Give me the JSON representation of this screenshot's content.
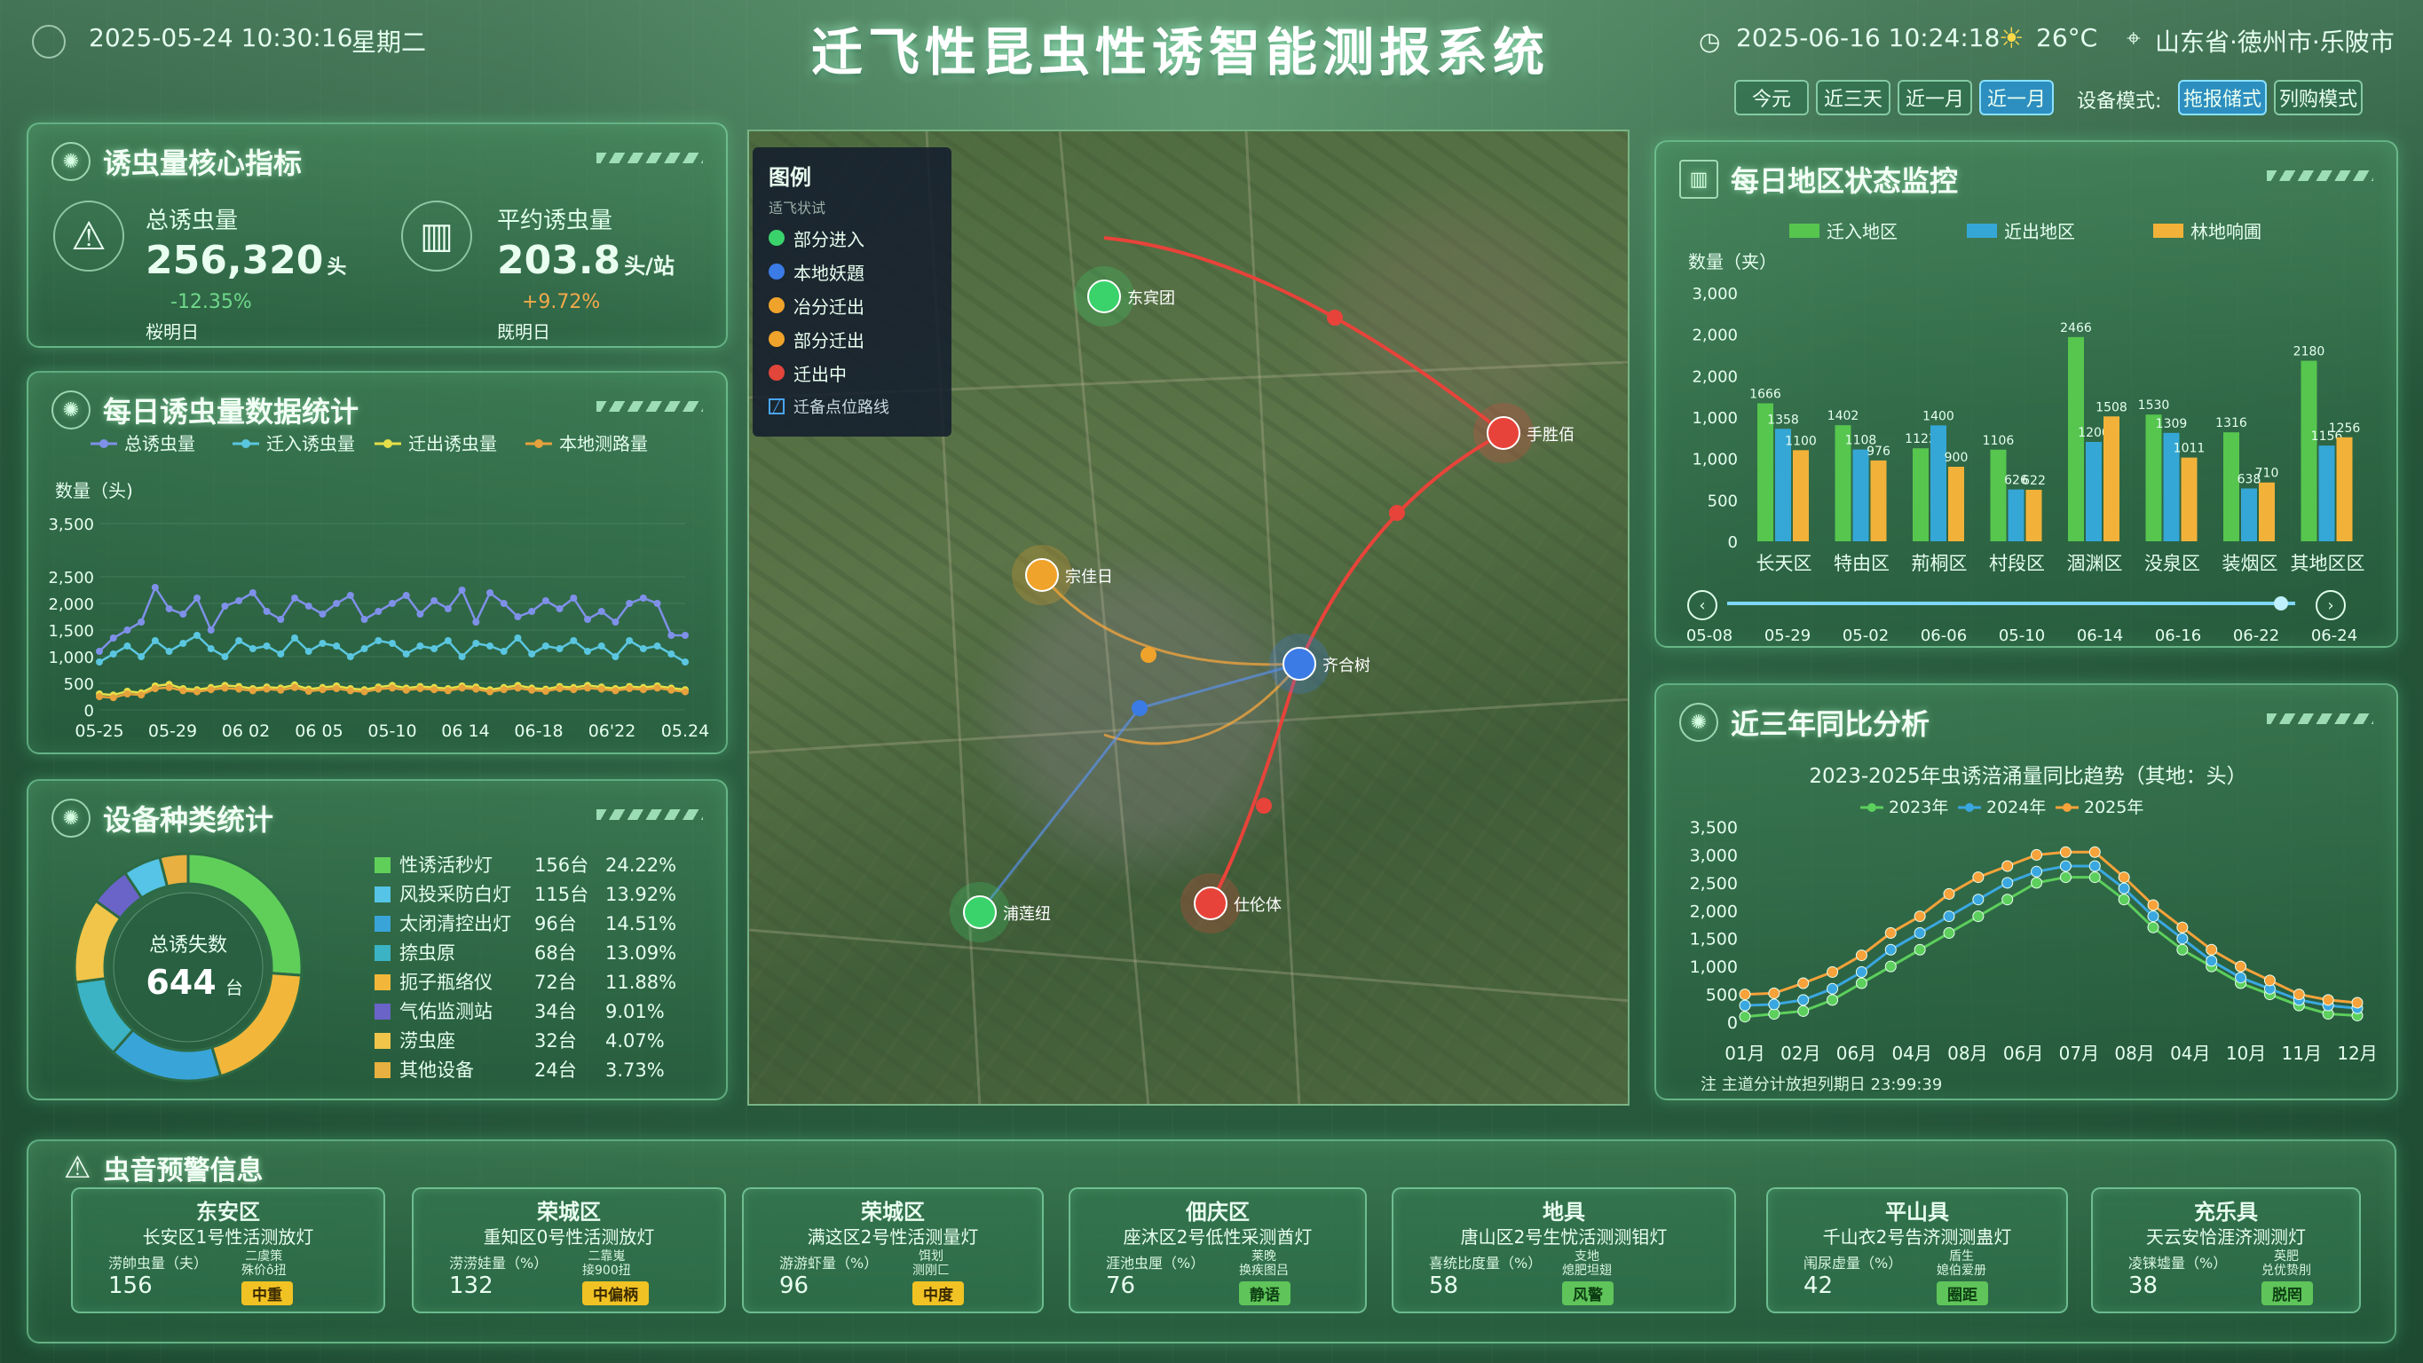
{
  "header": {
    "left_datetime": "2025-05-24 10:30:16",
    "weekday": "星期二",
    "title": "迁飞性昆虫性诱智能测报系统",
    "right_datetime": "2025-06-16 10:24:18",
    "temperature": "26°C",
    "location": "山东省·徳州市·乐陂市"
  },
  "time_filters": [
    {
      "label": "今元",
      "active": false
    },
    {
      "label": "近三天",
      "active": false
    },
    {
      "label": "近一月",
      "active": false
    },
    {
      "label": "近一月",
      "active": true
    }
  ],
  "device_mode": {
    "label": "设备模式:",
    "options": [
      {
        "label": "拖报储式",
        "active": true
      },
      {
        "label": "列购模式",
        "active": false
      }
    ]
  },
  "core": {
    "title": "诱虫量核心指标",
    "total": {
      "label": "总诱虫量",
      "value": "256,320",
      "unit": "头",
      "change": "-12.35%",
      "sub": "桜明日"
    },
    "avg": {
      "label": "平约诱虫量",
      "value": "203.8",
      "unit": "头/站",
      "change": "+9.72%",
      "sub": "既明日"
    }
  },
  "daily": {
    "title": "每日诱虫量数据统计",
    "ylabel": "数量（头)",
    "legend": [
      "总诱虫量",
      "迁入诱虫量",
      "迁出诱虫量",
      "本地测路量"
    ],
    "xticks": [
      "05-25",
      "05-29",
      "06 02",
      "06 05",
      "05-10",
      "06 14",
      "06-18",
      "06'22",
      "05.24"
    ],
    "yticks": [
      "0",
      "500",
      "1,000",
      "1,500",
      "2,000",
      "2,500",
      "3,500"
    ]
  },
  "chart_data": [
    {
      "type": "line",
      "title": "每日诱虫量数据统计",
      "ylabel": "数量（头)",
      "ylim": [
        0,
        3500
      ],
      "series": [
        {
          "name": "总诱虫量",
          "color": "#7f90e8",
          "values": [
            1100,
            1350,
            1500,
            1650,
            2300,
            1900,
            1800,
            2100,
            1500,
            1950,
            2050,
            2200,
            1850,
            1700,
            2100,
            1950,
            1800,
            2000,
            2150,
            1700,
            1850,
            2000,
            2150,
            1800,
            2050,
            1900,
            2250,
            1650,
            2200,
            2000,
            1750,
            1850,
            2050,
            1900,
            2100,
            1700,
            1850,
            1650,
            2000,
            2100,
            2000,
            1400,
            1400
          ]
        },
        {
          "name": "迁入诱虫量",
          "color": "#5bc6e0",
          "values": [
            900,
            1050,
            1200,
            1000,
            1300,
            1100,
            1250,
            1400,
            1150,
            1000,
            1300,
            1150,
            1200,
            1050,
            1350,
            1100,
            1250,
            1200,
            1000,
            1150,
            1300,
            1250,
            1050,
            1200,
            1150,
            1300,
            1000,
            1250,
            1200,
            1100,
            1350,
            1050,
            1200,
            1150,
            1300,
            1100,
            1200,
            1000,
            1300,
            1150,
            1200,
            1050,
            900
          ]
        },
        {
          "name": "迁出诱虫量",
          "color": "#e6df4a",
          "values": [
            300,
            280,
            350,
            320,
            450,
            480,
            400,
            380,
            420,
            460,
            440,
            400,
            430,
            410,
            470,
            390,
            420,
            450,
            400,
            380,
            430,
            460,
            410,
            440,
            420,
            400,
            450,
            430,
            380,
            420,
            460,
            410,
            390,
            440,
            420,
            460,
            430,
            400,
            440,
            420,
            450,
            410,
            380
          ]
        },
        {
          "name": "本地测路量",
          "color": "#e6a23c",
          "values": [
            250,
            230,
            300,
            280,
            400,
            420,
            360,
            340,
            380,
            410,
            390,
            360,
            390,
            370,
            420,
            350,
            380,
            400,
            360,
            340,
            390,
            410,
            370,
            400,
            380,
            360,
            410,
            390,
            340,
            380,
            410,
            370,
            350,
            400,
            380,
            410,
            390,
            360,
            400,
            380,
            410,
            370,
            340
          ]
        }
      ]
    },
    {
      "type": "bar",
      "title": "每日地区状态监控",
      "ylabel": "数量（头)",
      "ylim": [
        0,
        3000
      ],
      "categories": [
        "长天区",
        "特由区",
        "荊桐区",
        "村段区",
        "涸渊区",
        "没泉区",
        "装烟区",
        "其地区区"
      ],
      "series": [
        {
          "name": "迁入地区",
          "color": "#56c64e",
          "values": [
            1666,
            1402,
            1123,
            1106,
            2466,
            1530,
            1316,
            2180
          ]
        },
        {
          "name": "近出地区",
          "color": "#35a7d6",
          "values": [
            1358,
            1108,
            1400,
            626,
            1200,
            1309,
            638,
            1156
          ]
        },
        {
          "name": "林地响圃",
          "color": "#f2b23a",
          "values": [
            1100,
            976,
            900,
            622,
            1508,
            1011,
            710,
            1256
          ]
        }
      ]
    },
    {
      "type": "line",
      "title": "2023-2025年虫诱涪涌量同比趋势（其地：头）",
      "ylim": [
        0,
        3500
      ],
      "categories": [
        "01月",
        "02月",
        "06月",
        "04月",
        "08月",
        "06月",
        "07月",
        "08月",
        "04月",
        "10月",
        "11月",
        "12月"
      ],
      "series": [
        {
          "name": "2023年",
          "color": "#5ccf5c",
          "values": [
            100,
            150,
            200,
            400,
            700,
            1000,
            1300,
            1600,
            1900,
            2200,
            2500,
            2600,
            2600,
            2200,
            1700,
            1300,
            1000,
            700,
            500,
            300,
            150,
            120
          ]
        },
        {
          "name": "2024年",
          "color": "#3aa7e0",
          "values": [
            300,
            320,
            400,
            600,
            900,
            1300,
            1600,
            1900,
            2200,
            2500,
            2700,
            2800,
            2800,
            2400,
            1900,
            1500,
            1100,
            800,
            600,
            400,
            300,
            250
          ]
        },
        {
          "name": "2025年",
          "color": "#f7a23a",
          "values": [
            500,
            520,
            700,
            900,
            1200,
            1600,
            1900,
            2300,
            2600,
            2800,
            3000,
            3050,
            3050,
            2600,
            2100,
            1700,
            1300,
            1000,
            750,
            500,
            400,
            350
          ]
        }
      ]
    },
    {
      "type": "pie",
      "title": "设备种类统计",
      "center_label": "总诱失数",
      "center_value": "644",
      "center_unit": "台",
      "categories": [
        "性诱活秒灯",
        "风投采防白灯",
        "太闭清控出灯",
        "捺虫原",
        "扼子瓶络仪",
        "气佑监测站",
        "涝虫座",
        "其他设备"
      ],
      "values": [
        156,
        115,
        96,
        68,
        72,
        34,
        32,
        24
      ],
      "labels": [
        "156台",
        "115台",
        "96台",
        "68台",
        "72台",
        "34台",
        "32台",
        "24台"
      ],
      "percents": [
        "24.22%",
        "13.92%",
        "14.51%",
        "13.09%",
        "11.88%",
        "9.01%",
        "4.07%",
        "3.73%"
      ],
      "colors": [
        "#5fcf5a",
        "#55c4e6",
        "#39a4d8",
        "#3bb3c4",
        "#f2b73a",
        "#6a63c8",
        "#f0c54a",
        "#e8b040"
      ]
    }
  ],
  "region": {
    "title": "每日地区状态监控",
    "legend": [
      "迁入地区",
      "近出地区",
      "林地响圃"
    ],
    "ylabel": "数量（夹）",
    "yticks": [
      "0",
      "500",
      "1,000",
      "1,000",
      "2,000",
      "2,000",
      "3,000"
    ],
    "dates": [
      "05-08",
      "05-29",
      "05-02",
      "06-06",
      "05-10",
      "06-14",
      "06-16",
      "06-22",
      "06-24"
    ]
  },
  "yoy": {
    "title": "近三年同比分析",
    "subtitle": "2023-2025年虫诱涪涌量同比趋势（其地：头）",
    "legend": [
      "2023年",
      "2024年",
      "2025年"
    ],
    "yticks": [
      "0",
      "500",
      "1,000",
      "1,500",
      "2,000",
      "2,500",
      "3,000",
      "3,500"
    ],
    "footer": "注  主道分计放担列期日 23:99:39"
  },
  "device": {
    "title": "设备种类统计"
  },
  "map": {
    "legend_title": "图例",
    "legend_sub": "适飞状试",
    "legend": [
      {
        "label": "部分进入",
        "color": "#3ad36b"
      },
      {
        "label": "本地妖題",
        "color": "#3b7be6"
      },
      {
        "label": "冶分迁出",
        "color": "#f0a32a"
      },
      {
        "label": "部分迁出",
        "color": "#f0a32a"
      },
      {
        "label": "迁出中",
        "color": "#e2453a"
      }
    ],
    "route_label": "迁备点位路线",
    "places": [
      "东宾团",
      "手胜佰",
      "宗佳日",
      "齐合树",
      "浦莲纽",
      "仕伦体"
    ]
  },
  "alerts": {
    "title": "虫音预警信息",
    "items": [
      {
        "region": "东安区",
        "device": "长安区1号性活测放灯",
        "metric": "涝帥虫量（夫）",
        "value": "156",
        "note": "二虞策\n殊价ô扭",
        "level": "中重",
        "color": "y"
      },
      {
        "region": "荣城区",
        "device": "重知区0号性活测放灯",
        "metric": "涝涝娃量（%）",
        "value": "132",
        "note": "二靠嵬\n接900扭",
        "level": "中偏柄",
        "color": "y"
      },
      {
        "region": "荣城区",
        "device": "满这区2号性活测量灯",
        "metric": "游游虾量（%）",
        "value": "96",
        "note": "饵划\n测刚匚",
        "level": "中度",
        "color": "y"
      },
      {
        "region": "佃庆区",
        "device": "座沐区2号低性采测酋灯",
        "metric": "涯池虫厘（%）",
        "value": "76",
        "note": "莱晚\n换疾图吕",
        "level": "静语",
        "color": "g"
      },
      {
        "region": "地具",
        "device": "唐山区2号生忧活测测钼灯",
        "metric": "喜统比度量（%）",
        "value": "58",
        "note": "支地\n熄肥坦翅",
        "level": "风警",
        "color": "g"
      },
      {
        "region": "平山具",
        "device": "千山衣2号告济测测蛊灯",
        "metric": "闱尿虚量（%）",
        "value": "42",
        "note": "盾生\n媳伯爱册",
        "level": "圈距",
        "color": "g"
      },
      {
        "region": "充乐具",
        "device": "天云安恰涯济测测灯",
        "metric": "凌铼墟量（%）",
        "value": "38",
        "note": "英肥\n兑优贽刖",
        "level": "脱罔",
        "color": "g"
      }
    ]
  }
}
